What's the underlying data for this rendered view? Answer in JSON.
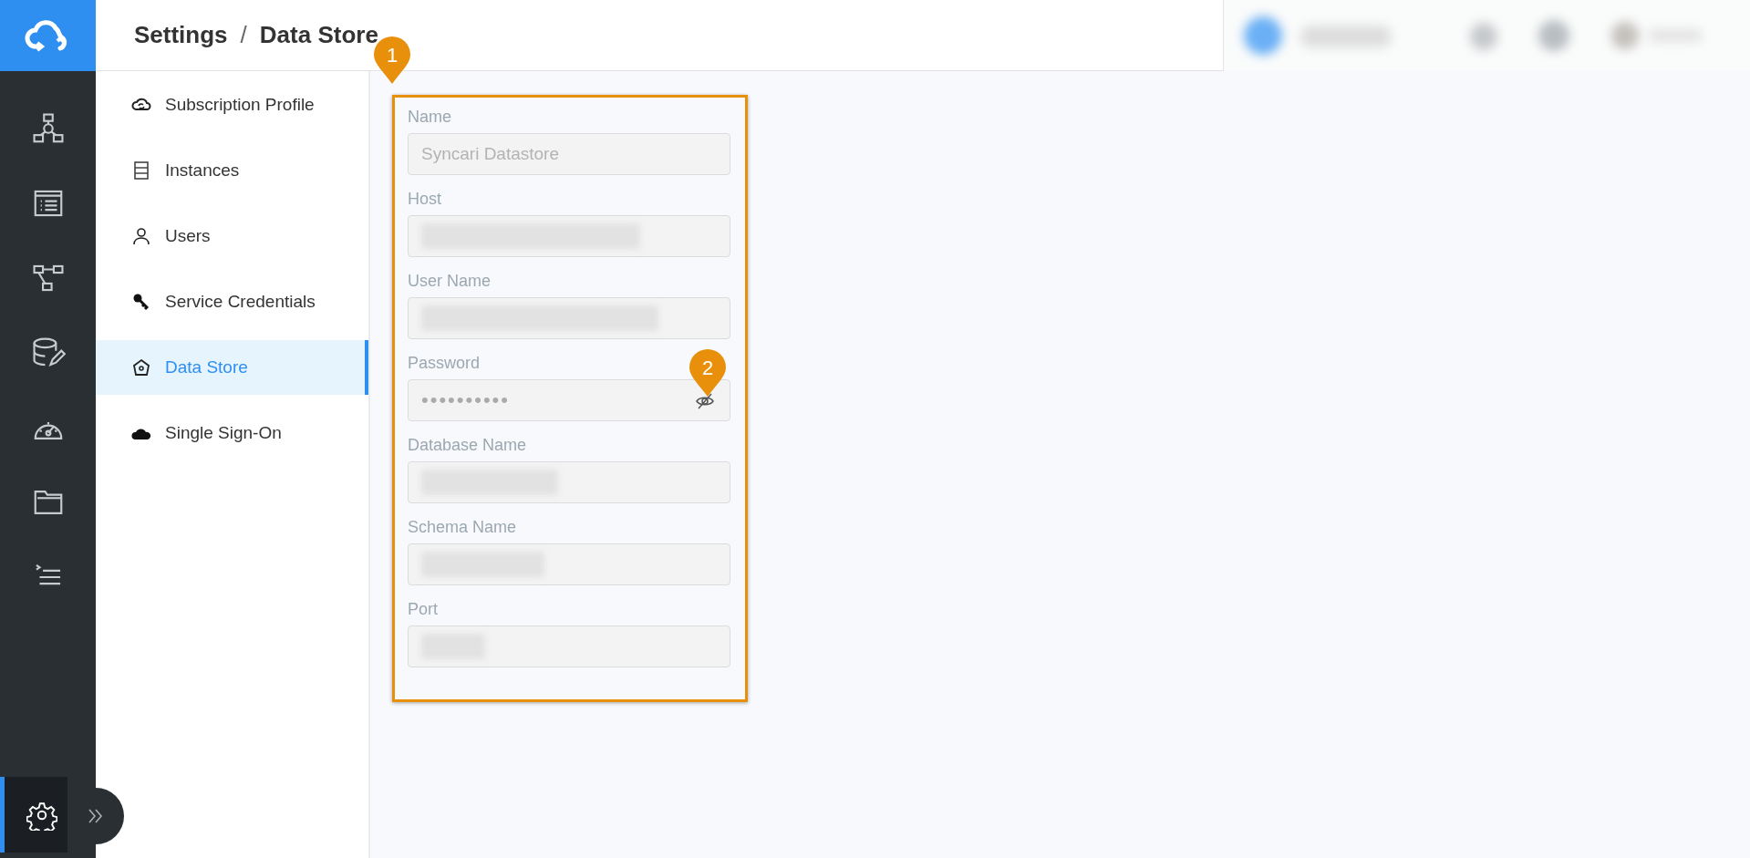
{
  "header": {
    "breadcrumb": [
      "Settings",
      "Data Store"
    ],
    "separator": "/"
  },
  "rail": {
    "items": [
      {
        "kind": "hierarchy",
        "selected": false
      },
      {
        "kind": "list",
        "selected": false
      },
      {
        "kind": "flow",
        "selected": false
      },
      {
        "kind": "database-edit",
        "selected": false
      },
      {
        "kind": "gauge",
        "selected": false
      },
      {
        "kind": "folder",
        "selected": false
      },
      {
        "kind": "task-list",
        "selected": false
      },
      {
        "kind": "settings",
        "selected": true
      }
    ]
  },
  "sidebar": {
    "items": [
      {
        "label": "Subscription Profile",
        "kind": "subscription",
        "selected": false
      },
      {
        "label": "Instances",
        "kind": "instances",
        "selected": false
      },
      {
        "label": "Users",
        "kind": "users",
        "selected": false
      },
      {
        "label": "Service Credentials",
        "kind": "credentials",
        "selected": false
      },
      {
        "label": "Data Store",
        "kind": "datastore",
        "selected": true
      },
      {
        "label": "Single Sign-On",
        "kind": "sso",
        "selected": false
      }
    ]
  },
  "form": {
    "fields": [
      {
        "label": "Name",
        "kind": "text",
        "value": "Syncari Datastore"
      },
      {
        "label": "Host",
        "kind": "redacted"
      },
      {
        "label": "User Name",
        "kind": "redacted"
      },
      {
        "label": "Password",
        "kind": "password",
        "value": "••••••••••"
      },
      {
        "label": "Database Name",
        "kind": "redacted"
      },
      {
        "label": "Schema Name",
        "kind": "redacted"
      },
      {
        "label": "Port",
        "kind": "redacted"
      }
    ]
  },
  "callouts": [
    "1",
    "2"
  ]
}
